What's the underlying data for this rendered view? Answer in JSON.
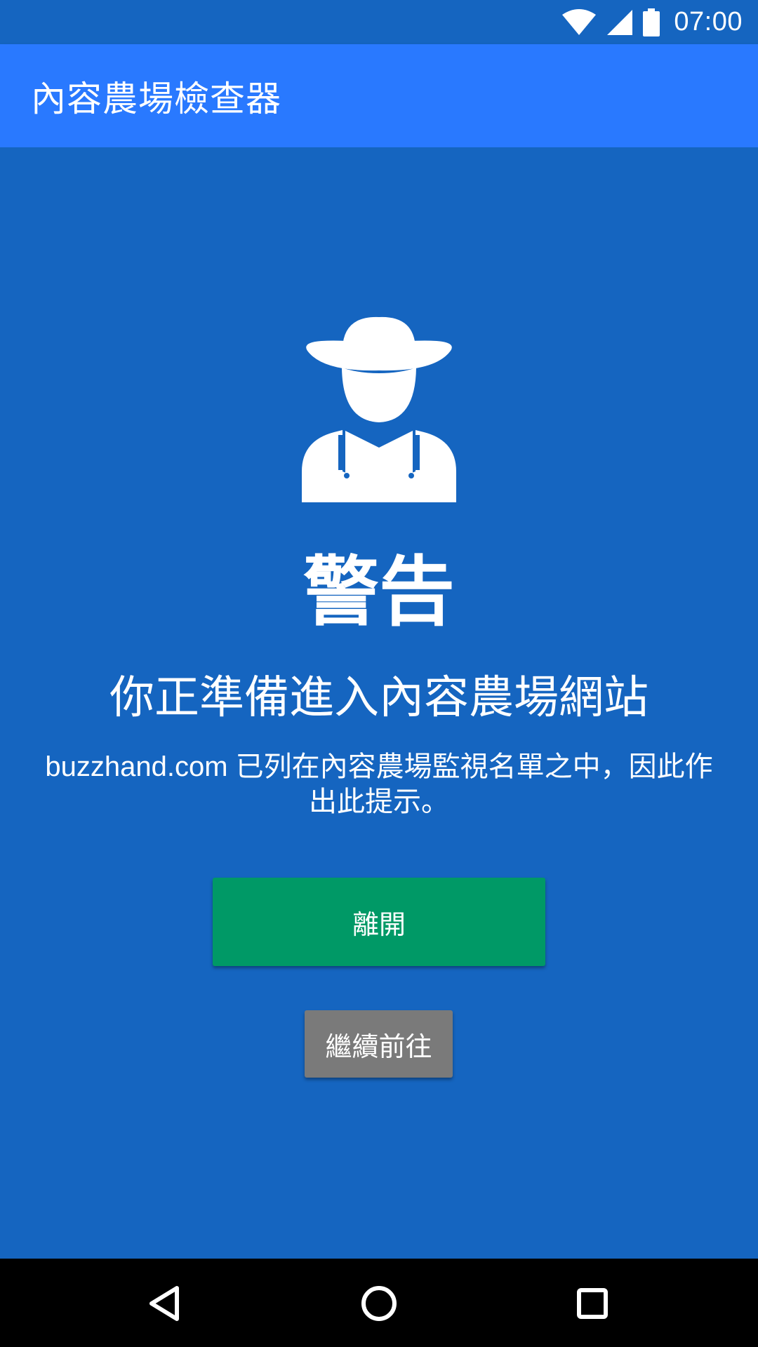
{
  "status_bar": {
    "time": "07:00",
    "icons": [
      "wifi-icon",
      "signal-icon",
      "battery-icon"
    ]
  },
  "app_bar": {
    "title": "內容農場檢查器"
  },
  "warning": {
    "icon": "farmer-icon",
    "title": "警告",
    "subtitle": "你正準備進入內容農場網站",
    "description": "buzzhand.com 已列在內容農場監視名單之中，因此作出此提示。"
  },
  "buttons": {
    "leave_label": "離開",
    "continue_label": "繼續前往"
  },
  "nav_bar": {
    "icons": [
      "back-icon",
      "home-icon",
      "recent-apps-icon"
    ]
  },
  "colors": {
    "background": "#1565C0",
    "app_bar": "#2979FF",
    "leave_button": "#009966",
    "continue_button": "#7A7A7A",
    "nav_bar": "#000000"
  }
}
